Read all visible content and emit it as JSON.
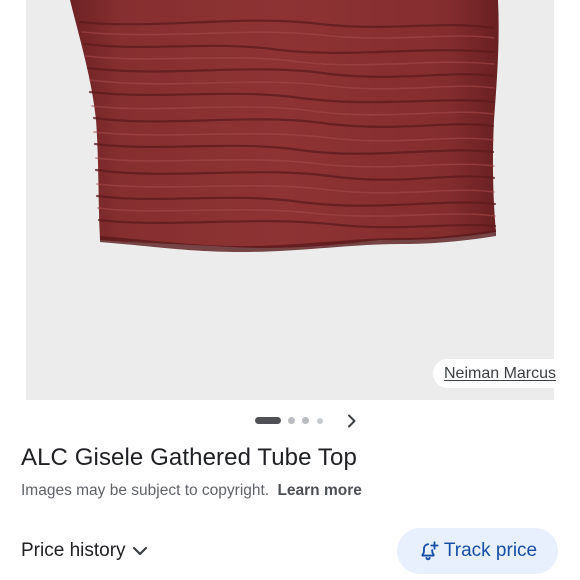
{
  "image": {
    "source_label": "Neiman Marcus",
    "product_color": "#862f30",
    "background_color": "#ececec"
  },
  "carousel": {
    "total_dots": 4,
    "active_index": 0,
    "next_icon": "chevron-right-icon"
  },
  "product": {
    "title": "ALC Gisele Gathered Tube Top"
  },
  "notice": {
    "copyright_text": "Images may be subject to copyright.",
    "learn_more_label": "Learn more"
  },
  "actions": {
    "price_history_label": "Price history",
    "price_history_icon": "chevron-down-icon",
    "track_price_label": "Track price",
    "track_price_icon": "bell-plus-icon",
    "track_button_color": "#e8f0fe",
    "track_text_color": "#174ea6"
  }
}
